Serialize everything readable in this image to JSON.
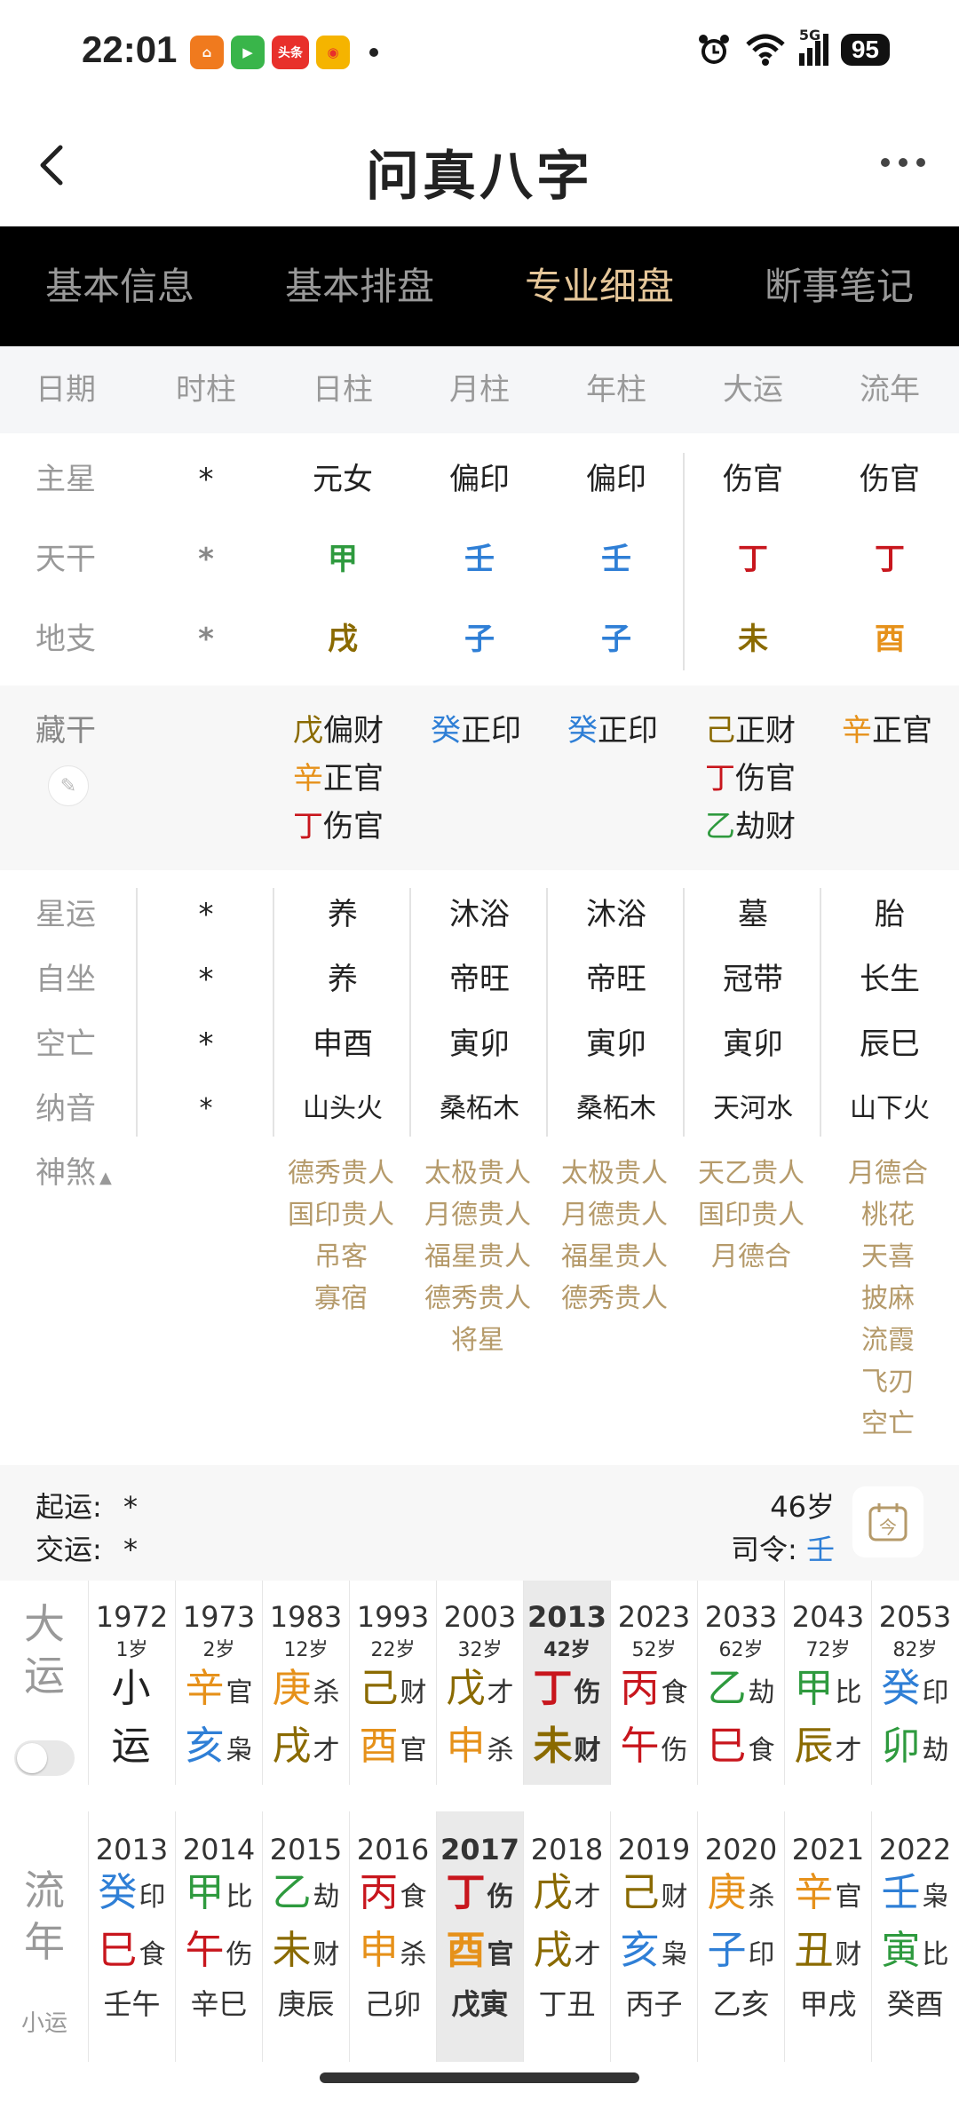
{
  "status": {
    "time": "22:01",
    "battery": "95",
    "toutiao": "头条",
    "signal_label": "5G"
  },
  "nav": {
    "title": "问真八字"
  },
  "tabs": [
    "基本信息",
    "基本排盘",
    "专业细盘",
    "断事笔记"
  ],
  "headers": [
    "日期",
    "时柱",
    "日柱",
    "月柱",
    "年柱",
    "大运",
    "流年"
  ],
  "zhuxing": {
    "label": "主星",
    "values": [
      "*",
      "元女",
      "偏印",
      "偏印",
      "伤官",
      "伤官"
    ]
  },
  "tiangan": {
    "label": "天干",
    "values": [
      "*",
      "甲",
      "壬",
      "壬",
      "丁",
      "丁"
    ]
  },
  "dizhi": {
    "label": "地支",
    "values": [
      "*",
      "戌",
      "子",
      "子",
      "未",
      "酉"
    ]
  },
  "canggan": {
    "label": "藏干",
    "cols": [
      [
        {
          "g": "戊",
          "s": "偏财"
        },
        {
          "g": "辛",
          "s": "正官"
        },
        {
          "g": "丁",
          "s": "伤官"
        }
      ],
      [
        {
          "g": "癸",
          "s": "正印"
        }
      ],
      [
        {
          "g": "癸",
          "s": "正印"
        }
      ],
      [
        {
          "g": "己",
          "s": "正财"
        },
        {
          "g": "丁",
          "s": "伤官"
        },
        {
          "g": "乙",
          "s": "劫财"
        }
      ],
      [
        {
          "g": "辛",
          "s": "正官"
        }
      ]
    ]
  },
  "xingyun": {
    "label": "星运",
    "values": [
      "*",
      "养",
      "沐浴",
      "沐浴",
      "墓",
      "胎"
    ]
  },
  "zizuo": {
    "label": "自坐",
    "values": [
      "*",
      "养",
      "帝旺",
      "帝旺",
      "冠带",
      "长生"
    ]
  },
  "kongwang": {
    "label": "空亡",
    "values": [
      "*",
      "申酉",
      "寅卯",
      "寅卯",
      "寅卯",
      "辰巳"
    ]
  },
  "nayin": {
    "label": "纳音",
    "values": [
      "*",
      "山头火",
      "桑柘木",
      "桑柘木",
      "天河水",
      "山下火"
    ]
  },
  "shensha": {
    "label": "神煞",
    "cols": [
      [
        "德秀贵人",
        "国印贵人",
        "吊客",
        "寡宿"
      ],
      [
        "太极贵人",
        "月德贵人",
        "福星贵人",
        "德秀贵人",
        "将星"
      ],
      [
        "太极贵人",
        "月德贵人",
        "福星贵人",
        "德秀贵人"
      ],
      [
        "天乙贵人",
        "国印贵人",
        "月德合"
      ],
      [
        "月德合",
        "桃花",
        "天喜",
        "披麻",
        "流霞",
        "飞刃",
        "空亡"
      ]
    ]
  },
  "qiyun": {
    "qi_label": "起运:",
    "qi_value": "*",
    "jiao_label": "交运:",
    "jiao_value": "*",
    "age": "46岁",
    "siling_label": "司令:",
    "siling_value": "壬",
    "calendar_char": "今"
  },
  "dayun": {
    "label": [
      "大",
      "运"
    ],
    "cols": [
      {
        "yr": "1972",
        "age": "1岁",
        "g": "小",
        "gs": "",
        "z": "运",
        "zs": ""
      },
      {
        "yr": "1973",
        "age": "2岁",
        "g": "辛",
        "gs": "官",
        "z": "亥",
        "zs": "枭"
      },
      {
        "yr": "1983",
        "age": "12岁",
        "g": "庚",
        "gs": "杀",
        "z": "戌",
        "zs": "才"
      },
      {
        "yr": "1993",
        "age": "22岁",
        "g": "己",
        "gs": "财",
        "z": "酉",
        "zs": "官"
      },
      {
        "yr": "2003",
        "age": "32岁",
        "g": "戊",
        "gs": "才",
        "z": "申",
        "zs": "杀"
      },
      {
        "yr": "2013",
        "age": "42岁",
        "g": "丁",
        "gs": "伤",
        "z": "未",
        "zs": "财"
      },
      {
        "yr": "2023",
        "age": "52岁",
        "g": "丙",
        "gs": "食",
        "z": "午",
        "zs": "伤"
      },
      {
        "yr": "2033",
        "age": "62岁",
        "g": "乙",
        "gs": "劫",
        "z": "巳",
        "zs": "食"
      },
      {
        "yr": "2043",
        "age": "72岁",
        "g": "甲",
        "gs": "比",
        "z": "辰",
        "zs": "才"
      },
      {
        "yr": "2053",
        "age": "82岁",
        "g": "癸",
        "gs": "印",
        "z": "卯",
        "zs": "劫"
      }
    ]
  },
  "liunian": {
    "label": [
      "流",
      "年"
    ],
    "sub_label": "小运",
    "cols": [
      {
        "yr": "2013",
        "g": "癸",
        "gs": "印",
        "z": "巳",
        "zs": "食",
        "x": "壬午"
      },
      {
        "yr": "2014",
        "g": "甲",
        "gs": "比",
        "z": "午",
        "zs": "伤",
        "x": "辛巳"
      },
      {
        "yr": "2015",
        "g": "乙",
        "gs": "劫",
        "z": "未",
        "zs": "财",
        "x": "庚辰"
      },
      {
        "yr": "2016",
        "g": "丙",
        "gs": "食",
        "z": "申",
        "zs": "杀",
        "x": "己卯"
      },
      {
        "yr": "2017",
        "g": "丁",
        "gs": "伤",
        "z": "酉",
        "zs": "官",
        "x": "戊寅"
      },
      {
        "yr": "2018",
        "g": "戊",
        "gs": "才",
        "z": "戌",
        "zs": "才",
        "x": "丁丑"
      },
      {
        "yr": "2019",
        "g": "己",
        "gs": "财",
        "z": "亥",
        "zs": "枭",
        "x": "丙子"
      },
      {
        "yr": "2020",
        "g": "庚",
        "gs": "杀",
        "z": "子",
        "zs": "印",
        "x": "乙亥"
      },
      {
        "yr": "2021",
        "g": "辛",
        "gs": "官",
        "z": "丑",
        "zs": "财",
        "x": "甲戌"
      },
      {
        "yr": "2022",
        "g": "壬",
        "gs": "枭",
        "z": "寅",
        "zs": "比",
        "x": "癸酉"
      }
    ]
  }
}
